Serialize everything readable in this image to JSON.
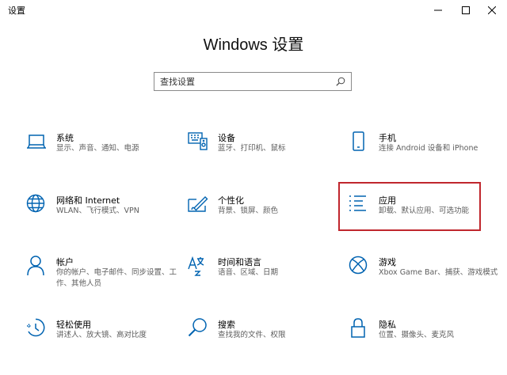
{
  "window": {
    "title": "设置",
    "minimize_icon": "minimize-icon",
    "maximize_icon": "maximize-icon",
    "close_icon": "close-icon"
  },
  "heading": "Windows 设置",
  "search": {
    "placeholder": "查找设置",
    "value": "",
    "icon": "search-icon"
  },
  "accent_color": "#0063b1",
  "highlight_color": "#c0262d",
  "tiles": [
    {
      "icon": "laptop-icon",
      "title": "系统",
      "desc": "显示、声音、通知、电源"
    },
    {
      "icon": "devices-icon",
      "title": "设备",
      "desc": "蓝牙、打印机、鼠标"
    },
    {
      "icon": "phone-icon",
      "title": "手机",
      "desc": "连接 Android 设备和 iPhone"
    },
    {
      "icon": "globe-icon",
      "title": "网络和 Internet",
      "desc": "WLAN、飞行模式、VPN"
    },
    {
      "icon": "personalize-icon",
      "title": "个性化",
      "desc": "背景、锁屏、颜色"
    },
    {
      "icon": "apps-icon",
      "title": "应用",
      "desc": "卸载、默认应用、可选功能",
      "highlighted": true
    },
    {
      "icon": "person-icon",
      "title": "帐户",
      "desc": "你的帐户、电子邮件、同步设置、工作、其他人员"
    },
    {
      "icon": "language-icon",
      "title": "时间和语言",
      "desc": "语音、区域、日期"
    },
    {
      "icon": "xbox-icon",
      "title": "游戏",
      "desc": "Xbox Game Bar、捕获、游戏模式"
    },
    {
      "icon": "ease-of-access-icon",
      "title": "轻松使用",
      "desc": "讲述人、放大镜、高对比度"
    },
    {
      "icon": "search-icon",
      "title": "搜索",
      "desc": "查找我的文件、权限"
    },
    {
      "icon": "lock-icon",
      "title": "隐私",
      "desc": "位置、摄像头、麦克风"
    }
  ]
}
